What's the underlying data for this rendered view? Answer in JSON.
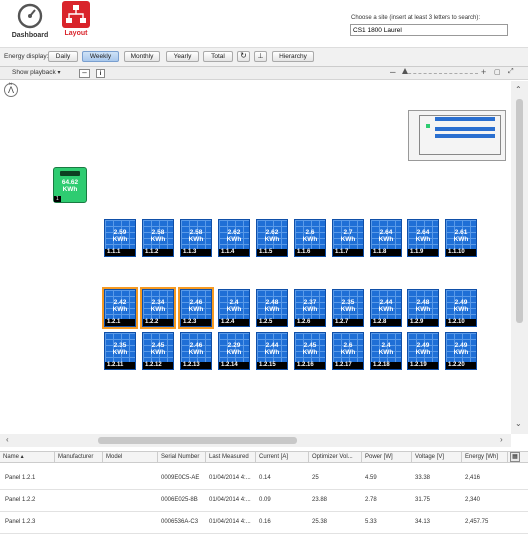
{
  "topbar": {
    "dashboard_label": "Dashboard",
    "layout_label": "Layout",
    "site_prompt": "Choose a site (insert at least 3 letters to search):",
    "site_value": "CS1 1800 Laurel"
  },
  "toolbar": {
    "energy_display_label": "Energy display:",
    "buttons": [
      "Daily",
      "Weekly",
      "Monthly",
      "Yearly",
      "Total"
    ],
    "selected": "Weekly",
    "hierarchy_label": "Hierarchy",
    "show_playback_label": "Show playback"
  },
  "inverter": {
    "value": "64.62",
    "unit": "KWh",
    "id": "1"
  },
  "panel_unit": "KWh",
  "panels": [
    {
      "label": "1.1.1",
      "value": "2.59",
      "highlight": false
    },
    {
      "label": "1.1.2",
      "value": "2.58",
      "highlight": false
    },
    {
      "label": "1.1.3",
      "value": "2.58",
      "highlight": false
    },
    {
      "label": "1.1.4",
      "value": "2.62",
      "highlight": false
    },
    {
      "label": "1.1.5",
      "value": "2.62",
      "highlight": false
    },
    {
      "label": "1.1.6",
      "value": "2.6",
      "highlight": false
    },
    {
      "label": "1.1.7",
      "value": "2.7",
      "highlight": false
    },
    {
      "label": "1.1.8",
      "value": "2.64",
      "highlight": false
    },
    {
      "label": "1.1.9",
      "value": "2.64",
      "highlight": false
    },
    {
      "label": "1.1.10",
      "value": "2.61",
      "highlight": false
    },
    {
      "label": "1.2.1",
      "value": "2.42",
      "highlight": true
    },
    {
      "label": "1.2.2",
      "value": "2.34",
      "highlight": true
    },
    {
      "label": "1.2.3",
      "value": "2.46",
      "highlight": true
    },
    {
      "label": "1.2.4",
      "value": "2.4",
      "highlight": false
    },
    {
      "label": "1.2.5",
      "value": "2.48",
      "highlight": false
    },
    {
      "label": "1.2.6",
      "value": "2.37",
      "highlight": false
    },
    {
      "label": "1.2.7",
      "value": "2.35",
      "highlight": false
    },
    {
      "label": "1.2.8",
      "value": "2.44",
      "highlight": false
    },
    {
      "label": "1.2.9",
      "value": "2.48",
      "highlight": false
    },
    {
      "label": "1.2.10",
      "value": "2.49",
      "highlight": false
    },
    {
      "label": "1.2.11",
      "value": "2.35",
      "highlight": false
    },
    {
      "label": "1.2.12",
      "value": "2.45",
      "highlight": false
    },
    {
      "label": "1.2.13",
      "value": "2.46",
      "highlight": false
    },
    {
      "label": "1.2.14",
      "value": "2.29",
      "highlight": false
    },
    {
      "label": "1.2.15",
      "value": "2.44",
      "highlight": false
    },
    {
      "label": "1.2.16",
      "value": "2.45",
      "highlight": false
    },
    {
      "label": "1.2.17",
      "value": "2.6",
      "highlight": false
    },
    {
      "label": "1.2.18",
      "value": "2.4",
      "highlight": false
    },
    {
      "label": "1.2.19",
      "value": "2.49",
      "highlight": false
    },
    {
      "label": "1.2.20",
      "value": "2.49",
      "highlight": false
    }
  ],
  "table": {
    "columns": [
      "Name ▴",
      "Manufacturer",
      "Model",
      "Serial Number",
      "Last Measured",
      "Current [A]",
      "Optimizer Vol...",
      "Power [W]",
      "Voltage [V]",
      "Energy [Wh]"
    ],
    "rows": [
      [
        "Panel 1.2.1",
        "",
        "",
        "0009E0C5-AE",
        "01/04/2014 4:...",
        "0.14",
        "25",
        "4.59",
        "33.38",
        "2,416"
      ],
      [
        "Panel 1.2.2",
        "",
        "",
        "0006E025-8B",
        "01/04/2014 4:...",
        "0.09",
        "23.88",
        "2.78",
        "31.75",
        "2,340"
      ],
      [
        "Panel 1.2.3",
        "",
        "",
        "0006536A-C3",
        "01/04/2014 4:...",
        "0.16",
        "25.38",
        "5.33",
        "34.13",
        "2,457.75"
      ]
    ]
  },
  "colors": {
    "accent": "#d9242b",
    "panel": "#1f6fd6",
    "highlight": "#f59a23",
    "inverter": "#2ecc71"
  }
}
